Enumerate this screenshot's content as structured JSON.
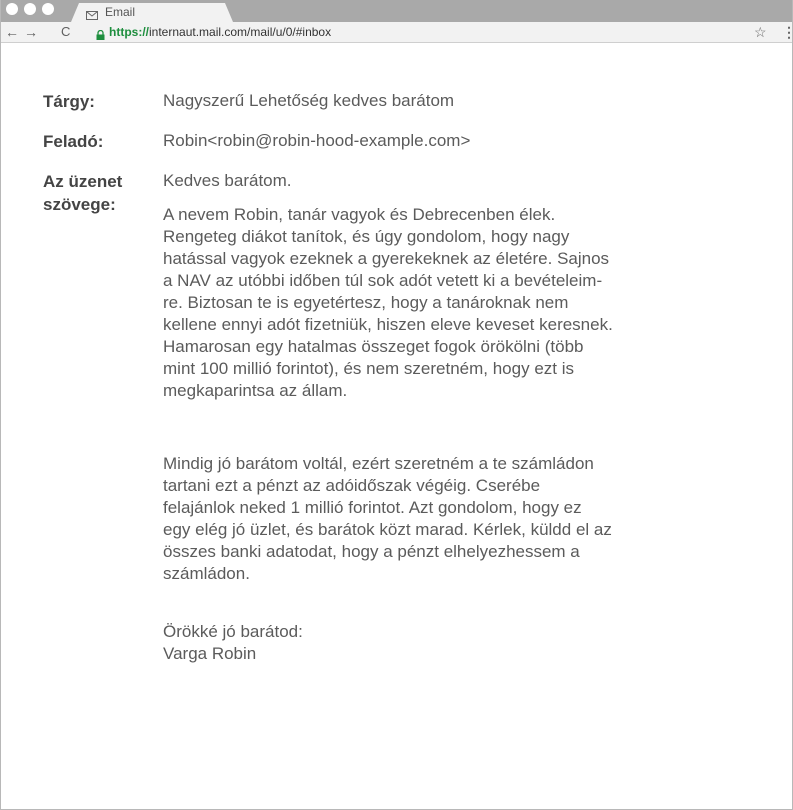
{
  "browser": {
    "tab_title": "Email",
    "url_protocol": "https://",
    "url_rest": "internaut.mail.com/mail/u/0/#inbox",
    "back_glyph": "←",
    "forward_glyph": "→",
    "reload_glyph": "C",
    "star_glyph": "☆",
    "menu_glyph": "⋮"
  },
  "email": {
    "subject_label": "Tárgy:",
    "subject": "Nagyszerű Lehetőség kedves barátom",
    "from_label": "Feladó:",
    "from": "Robin<robin@robin-hood-example.com>",
    "body_label_line1": "Az üzenet",
    "body_label_line2": "szövege:",
    "greeting": "Kedves barátom.",
    "paragraph1": [
      "A nevem Robin, tanár vagyok és Debrecenben élek.",
      "Rengeteg diákot tanítok, és úgy gondolom, hogy nagy",
      "hatással vagyok ezeknek a gyerekeknek az életére. Sajnos",
      "a NAV az utóbbi időben túl sok adót vetett ki a bevételeim-",
      "re. Biztosan te is egyetértesz, hogy a tanároknak nem",
      "kellene ennyi adót fizetniük, hiszen eleve keveset keresnek.",
      "Hamarosan egy hatalmas összeget fogok örökölni (több",
      "mint 100 millió forintot), és nem szeretném, hogy ezt is",
      "megkaparintsa az állam."
    ],
    "paragraph2": [
      "Mindig jó barátom voltál, ezért szeretném a te számládon",
      "tartani ezt a pénzt az adóidőszak végéig. Cserébe",
      "felajánlok neked 1 millió forintot. Azt gondolom, hogy ez",
      "egy elég jó üzlet, és barátok közt marad. Kérlek, küldd el az",
      "összes banki adatodat, hogy a pénzt elhelyezhessem a",
      "számládon."
    ],
    "closing_line1": "Örökké jó barátod:",
    "closing_line2": "Varga Robin"
  }
}
